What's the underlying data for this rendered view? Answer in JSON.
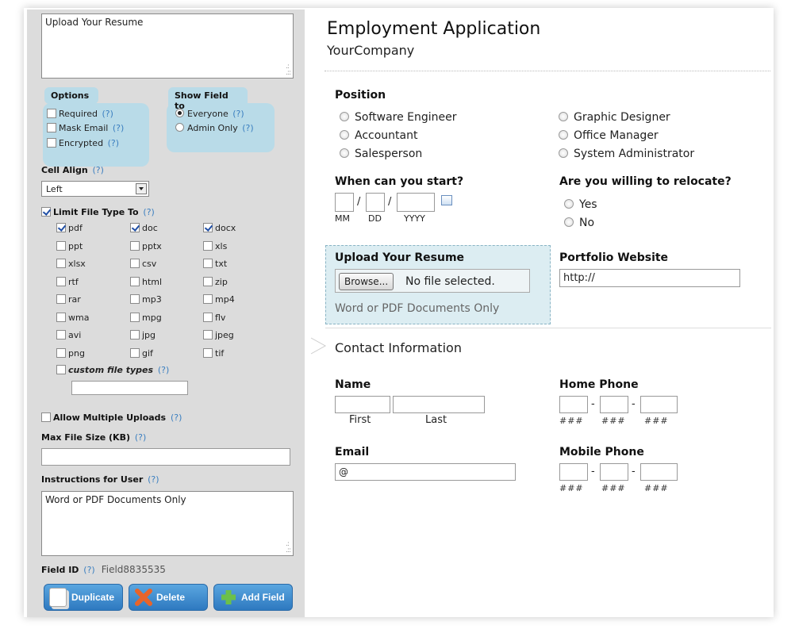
{
  "left": {
    "field_label_value": "Upload Your Resume",
    "options": {
      "title": "Options",
      "items": [
        "Required",
        "Mask Email",
        "Encrypted"
      ],
      "qm": "(?)"
    },
    "show_field": {
      "title": "Show Field to",
      "items": [
        "Everyone",
        "Admin Only"
      ],
      "selected": "Everyone"
    },
    "cell_align": {
      "label": "Cell Align",
      "value": "Left"
    },
    "limit_file_type": {
      "label": "Limit File Type To",
      "types": [
        "pdf",
        "doc",
        "docx",
        "ppt",
        "pptx",
        "xls",
        "xlsx",
        "csv",
        "txt",
        "rtf",
        "html",
        "zip",
        "rar",
        "mp3",
        "mp4",
        "wma",
        "mpg",
        "flv",
        "avi",
        "jpg",
        "jpeg",
        "png",
        "gif",
        "tif"
      ],
      "checked": [
        "pdf",
        "doc",
        "docx"
      ],
      "custom_label": "custom file types"
    },
    "allow_multiple": "Allow Multiple Uploads",
    "max_size_label": "Max File Size (KB)",
    "instructions_label": "Instructions for User",
    "instructions_value": "Word or PDF Documents Only",
    "field_id_label": "Field ID",
    "field_id_value": "Field8835535",
    "buttons": {
      "duplicate": "Duplicate",
      "delete": "Delete",
      "add": "Add Field"
    }
  },
  "form": {
    "title": "Employment Application",
    "company": "YourCompany",
    "position": {
      "label": "Position",
      "col1": [
        "Software Engineer",
        "Accountant",
        "Salesperson"
      ],
      "col2": [
        "Graphic Designer",
        "Office Manager",
        "System Administrator"
      ]
    },
    "start": {
      "label": "When can you start?",
      "sub": [
        "MM",
        "DD",
        "YYYY"
      ],
      "sep": "/"
    },
    "relocate": {
      "label": "Are you willing to relocate?",
      "options": [
        "Yes",
        "No"
      ]
    },
    "upload": {
      "label": "Upload Your Resume",
      "browse": "Browse...",
      "status": "No file selected.",
      "instructions": "Word or PDF Documents Only"
    },
    "portfolio": {
      "label": "Portfolio Website",
      "value": "http://"
    },
    "contact": "Contact Information",
    "name": {
      "label": "Name",
      "first": "First",
      "last": "Last"
    },
    "home_phone": {
      "label": "Home Phone",
      "mask": "###",
      "sep": "-"
    },
    "email": {
      "label": "Email",
      "value": "@"
    },
    "mobile_phone": {
      "label": "Mobile Phone",
      "mask": "###",
      "sep": "-"
    }
  }
}
